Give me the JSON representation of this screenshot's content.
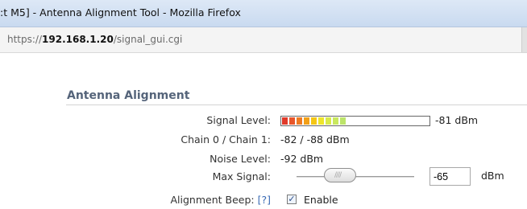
{
  "window": {
    "title": ":t M5] - Antenna Alignment Tool - Mozilla Firefox"
  },
  "address_bar": {
    "prefix": "https://",
    "host": "192.168.1.20",
    "path": "/signal_gui.cgi"
  },
  "section": {
    "title": "Antenna Alignment"
  },
  "fields": {
    "signal_level": {
      "label": "Signal Level:",
      "value": "-81 dBm",
      "meter_colors": [
        "#e03a2a",
        "#e8562a",
        "#ee7a22",
        "#f2a018",
        "#f5c614",
        "#eee52a",
        "#d9ea4a",
        "#c9e85e",
        "#bde46a"
      ]
    },
    "chains": {
      "label": "Chain 0 / Chain 1:",
      "value": "-82 / -88 dBm"
    },
    "noise_level": {
      "label": "Noise Level:",
      "value": "-92 dBm"
    },
    "max_signal": {
      "label": "Max Signal:",
      "input_value": "-65",
      "unit": "dBm"
    },
    "alignment_beep": {
      "label": "Alignment Beep:",
      "help": "[?]",
      "checked": true,
      "checkbox_label": "Enable"
    }
  }
}
